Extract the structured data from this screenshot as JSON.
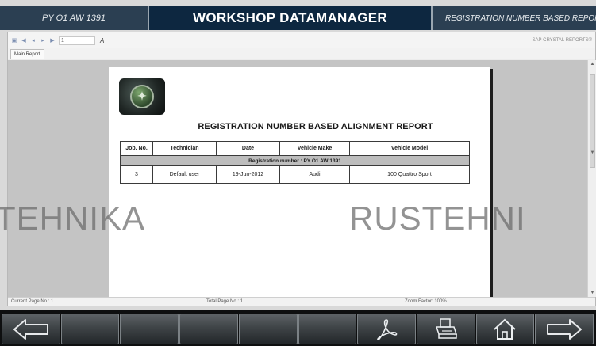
{
  "header": {
    "left_label": "PY O1 AW 1391",
    "title": "WORKSHOP DATAMANAGER",
    "right_label": "REGISTRATION NUMBER BASED REPOR"
  },
  "viewer_toolbar": {
    "page_input": "1",
    "find_label": "A",
    "right_link": "SAP CRYSTAL REPORTS®"
  },
  "tabs": [
    {
      "label": "Main Report"
    }
  ],
  "report": {
    "title": "REGISTRATION NUMBER BASED ALIGNMENT REPORT",
    "columns": [
      "Job. No.",
      "Technician",
      "Date",
      "Vehicle Make",
      "Vehicle Model"
    ],
    "group_label": "Registration number : PY O1 AW 1391",
    "rows": [
      [
        "3",
        "Default user",
        "19-Jun-2012",
        "Audi",
        "100 Quattro Sport"
      ]
    ]
  },
  "status_bar": {
    "current_page": "Current Page No.: 1",
    "total_page": "Total Page No.: 1",
    "zoom": "Zoom Factor: 100%"
  },
  "watermark": {
    "left": "TEHNIKA",
    "right": "RUSTEHNI"
  },
  "nav_buttons": [
    {
      "icon": "arrow-left-icon"
    },
    {
      "icon": ""
    },
    {
      "icon": ""
    },
    {
      "icon": ""
    },
    {
      "icon": ""
    },
    {
      "icon": ""
    },
    {
      "icon": "pdf-icon"
    },
    {
      "icon": "printer-icon"
    },
    {
      "icon": "home-icon"
    },
    {
      "icon": "arrow-right-icon"
    }
  ],
  "colors": {
    "header_dark": "#0d2740",
    "header_side": "#2b3f52",
    "navbar_bg": "#0e0f10",
    "group_row_bg": "#bdbdbd"
  }
}
